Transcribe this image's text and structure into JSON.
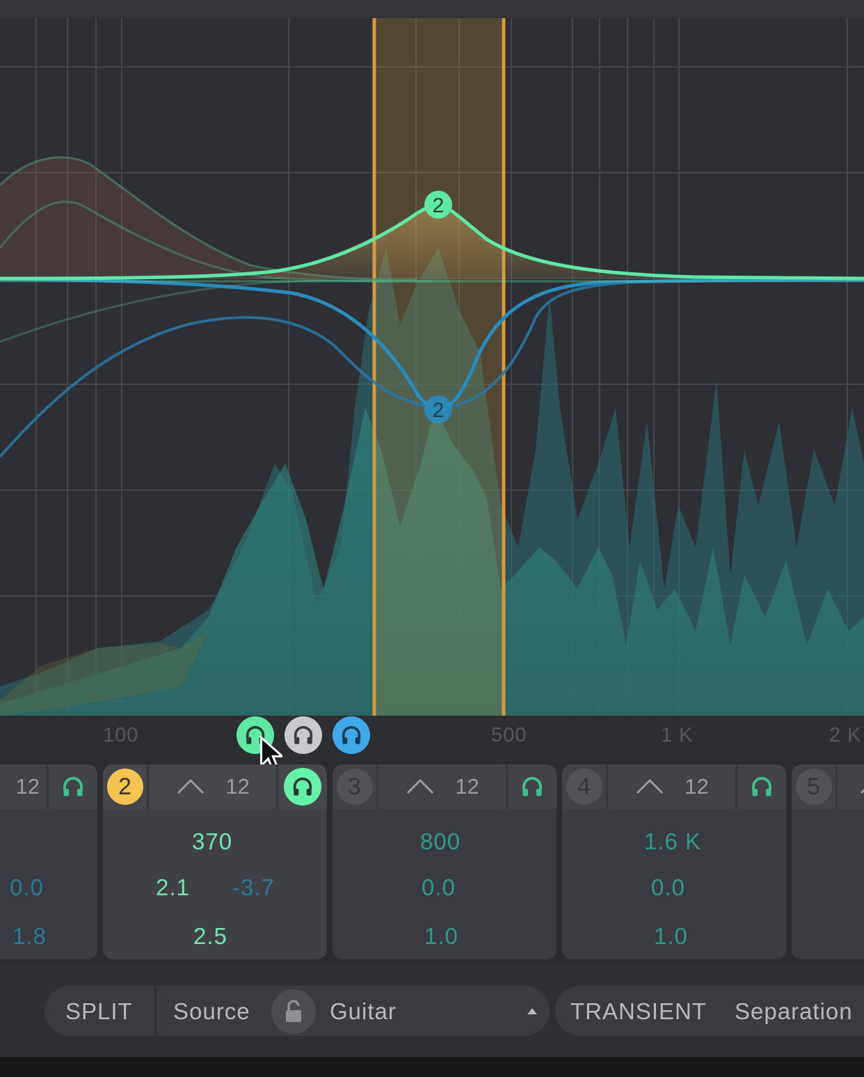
{
  "graph": {
    "nodes": [
      {
        "label": "2",
        "color": "#5fe8a5",
        "freq_hz": 370,
        "gain_db": 2.1
      },
      {
        "label": "2",
        "color": "#2a8bbd",
        "freq_hz": 370,
        "gain_db": -3.7
      }
    ],
    "highlight_band": {
      "color": "#d49a3c"
    }
  },
  "axis": {
    "labels": [
      "100",
      "500",
      "1 K",
      "2 K"
    ]
  },
  "solo_buttons": [
    {
      "icon": "headphones-icon",
      "color": "#5fe8a5"
    },
    {
      "icon": "headphones-icon",
      "color": "#c9cacd"
    },
    {
      "icon": "headphones-icon",
      "color": "#3fa9ea"
    }
  ],
  "bands": [
    {
      "slope": "12",
      "values": {
        "gain_a": "0.0",
        "q": "1.8"
      }
    },
    {
      "number": "2",
      "slope": "12",
      "values": {
        "freq": "370",
        "gain_a": "2.1",
        "gain_b": "-3.7",
        "q": "2.5"
      }
    },
    {
      "number": "3",
      "slope": "12",
      "values": {
        "freq": "800",
        "gain_a": "0.0",
        "q": "1.0"
      }
    },
    {
      "number": "4",
      "slope": "12",
      "values": {
        "freq": "1.6 K",
        "gain_a": "0.0",
        "q": "1.0"
      }
    },
    {
      "number": "5"
    }
  ],
  "bottom_bar": {
    "split_label": "SPLIT",
    "source_label": "Source",
    "source_value": "Guitar",
    "dropdown_icon": "triangle-up-icon",
    "lock_icon": "unlocked-padlock-icon",
    "transient_label": "TRANSIENT",
    "separation_label": "Separation"
  },
  "colors": {
    "green_curve": "#5fe8a5",
    "blue_curve": "#2a8bbd",
    "band_highlight": "#d49a3c",
    "active_band_number": "#f3c451"
  }
}
